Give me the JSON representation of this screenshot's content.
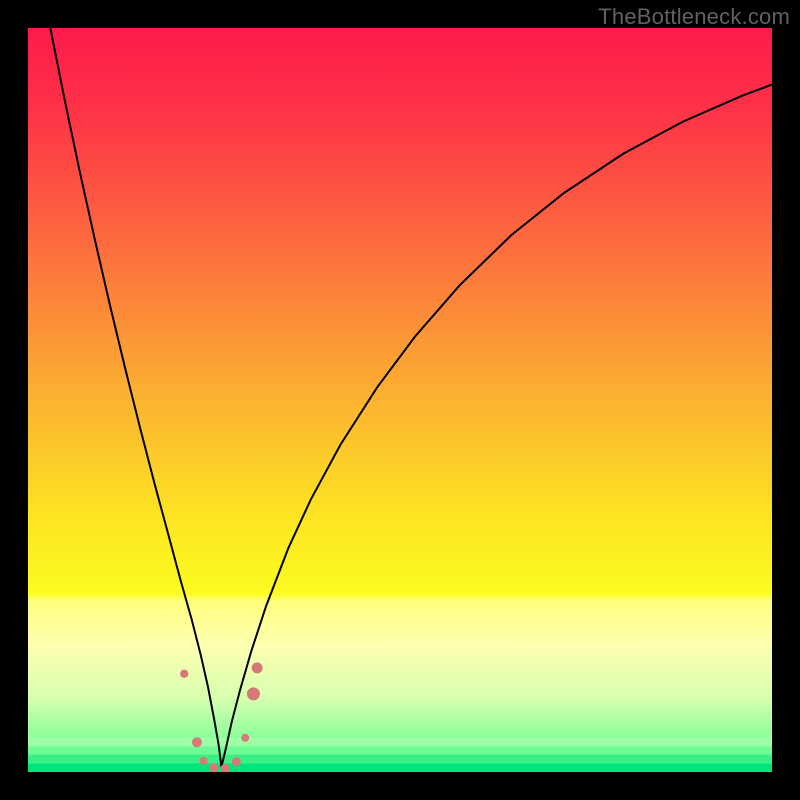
{
  "watermark": "TheBottleneck.com",
  "colors": {
    "black": "#000000",
    "curve": "#000000",
    "marker": "#d57a76"
  },
  "chart_data": {
    "type": "line",
    "title": "",
    "xlabel": "",
    "ylabel": "",
    "xlim": [
      0,
      100
    ],
    "ylim": [
      0,
      100
    ],
    "x_minimum": 26,
    "background_gradient": [
      {
        "offset": 0.0,
        "color": "#fe1a4a"
      },
      {
        "offset": 0.12,
        "color": "#fe3547"
      },
      {
        "offset": 0.3,
        "color": "#fd6f3e"
      },
      {
        "offset": 0.5,
        "color": "#fcb331"
      },
      {
        "offset": 0.66,
        "color": "#fde522"
      },
      {
        "offset": 0.76,
        "color": "#fcfc1f"
      },
      {
        "offset": 0.77,
        "color": "#feff7d"
      },
      {
        "offset": 0.83,
        "color": "#feffb0"
      },
      {
        "offset": 0.9,
        "color": "#d7ffaf"
      },
      {
        "offset": 0.955,
        "color": "#8aff9b"
      },
      {
        "offset": 1.0,
        "color": "#00e47b"
      }
    ],
    "optimal_band": {
      "y_from": 0,
      "y_to": 4.5,
      "stops": [
        {
          "y": 0.0,
          "color": "#00e47b"
        },
        {
          "y": 1.2,
          "color": "#3af086"
        },
        {
          "y": 2.4,
          "color": "#6dfb94"
        },
        {
          "y": 3.5,
          "color": "#9cffa7"
        },
        {
          "y": 4.5,
          "color": "#caffb0"
        }
      ]
    },
    "series": [
      {
        "name": "bottleneck-curve",
        "x": [
          3,
          5,
          7,
          9,
          11,
          13,
          15,
          17,
          19,
          20.5,
          22,
          23.2,
          24.2,
          25,
          25.6,
          26,
          26.6,
          27.4,
          28.5,
          30,
          32,
          35,
          38,
          42,
          47,
          52,
          58,
          65,
          72,
          80,
          88,
          96,
          100
        ],
        "y": [
          100,
          90,
          80.5,
          71.5,
          62.8,
          54.5,
          46.5,
          38.8,
          31.4,
          25.8,
          20.5,
          15.8,
          11.4,
          7.2,
          3.8,
          0.7,
          3.2,
          6.8,
          11,
          16.2,
          22.3,
          30.1,
          36.6,
          44.0,
          51.8,
          58.5,
          65.4,
          72.2,
          77.8,
          83.1,
          87.4,
          90.9,
          92.4
        ]
      }
    ],
    "markers": [
      {
        "x": 21.0,
        "y": 13.2,
        "r": 4.2
      },
      {
        "x": 22.7,
        "y": 4.0,
        "r": 5.0
      },
      {
        "x": 23.6,
        "y": 1.5,
        "r": 4.0
      },
      {
        "x": 25.0,
        "y": 0.6,
        "r": 4.5
      },
      {
        "x": 26.5,
        "y": 0.5,
        "r": 4.5
      },
      {
        "x": 28.0,
        "y": 1.4,
        "r": 4.4
      },
      {
        "x": 29.2,
        "y": 4.6,
        "r": 4.0
      },
      {
        "x": 30.3,
        "y": 10.5,
        "r": 6.5
      },
      {
        "x": 30.8,
        "y": 14.0,
        "r": 5.5
      }
    ]
  }
}
